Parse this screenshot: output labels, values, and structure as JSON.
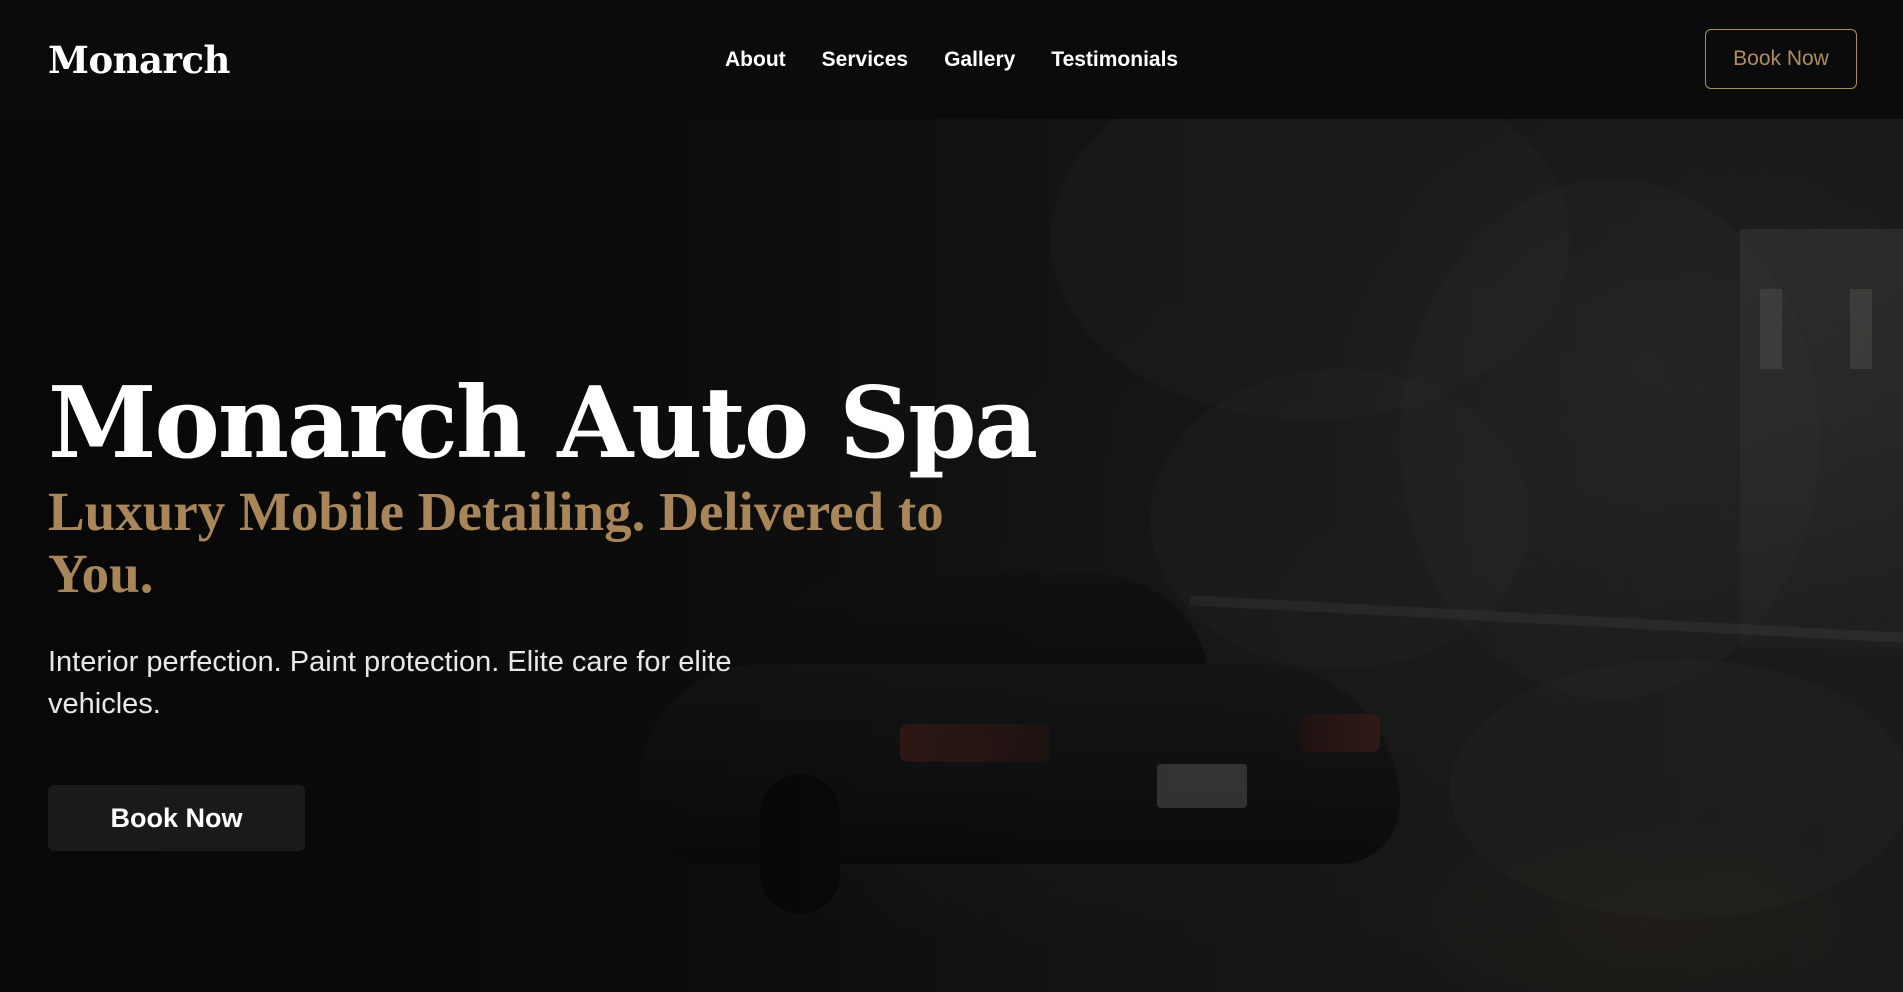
{
  "nav": {
    "logo": "Monarch",
    "links": [
      "About",
      "Services",
      "Gallery",
      "Testimonials"
    ],
    "cta": "Book Now"
  },
  "hero": {
    "title": "Monarch Auto Spa",
    "subtitle": "Luxury Mobile Detailing. Delivered to You.",
    "description": "Interior perfection. Paint protection. Elite care for elite vehicles.",
    "cta": "Book Now"
  },
  "colors": {
    "accent": "#a8865a",
    "background": "#0b0b0b",
    "button": "#1a1a1a"
  }
}
